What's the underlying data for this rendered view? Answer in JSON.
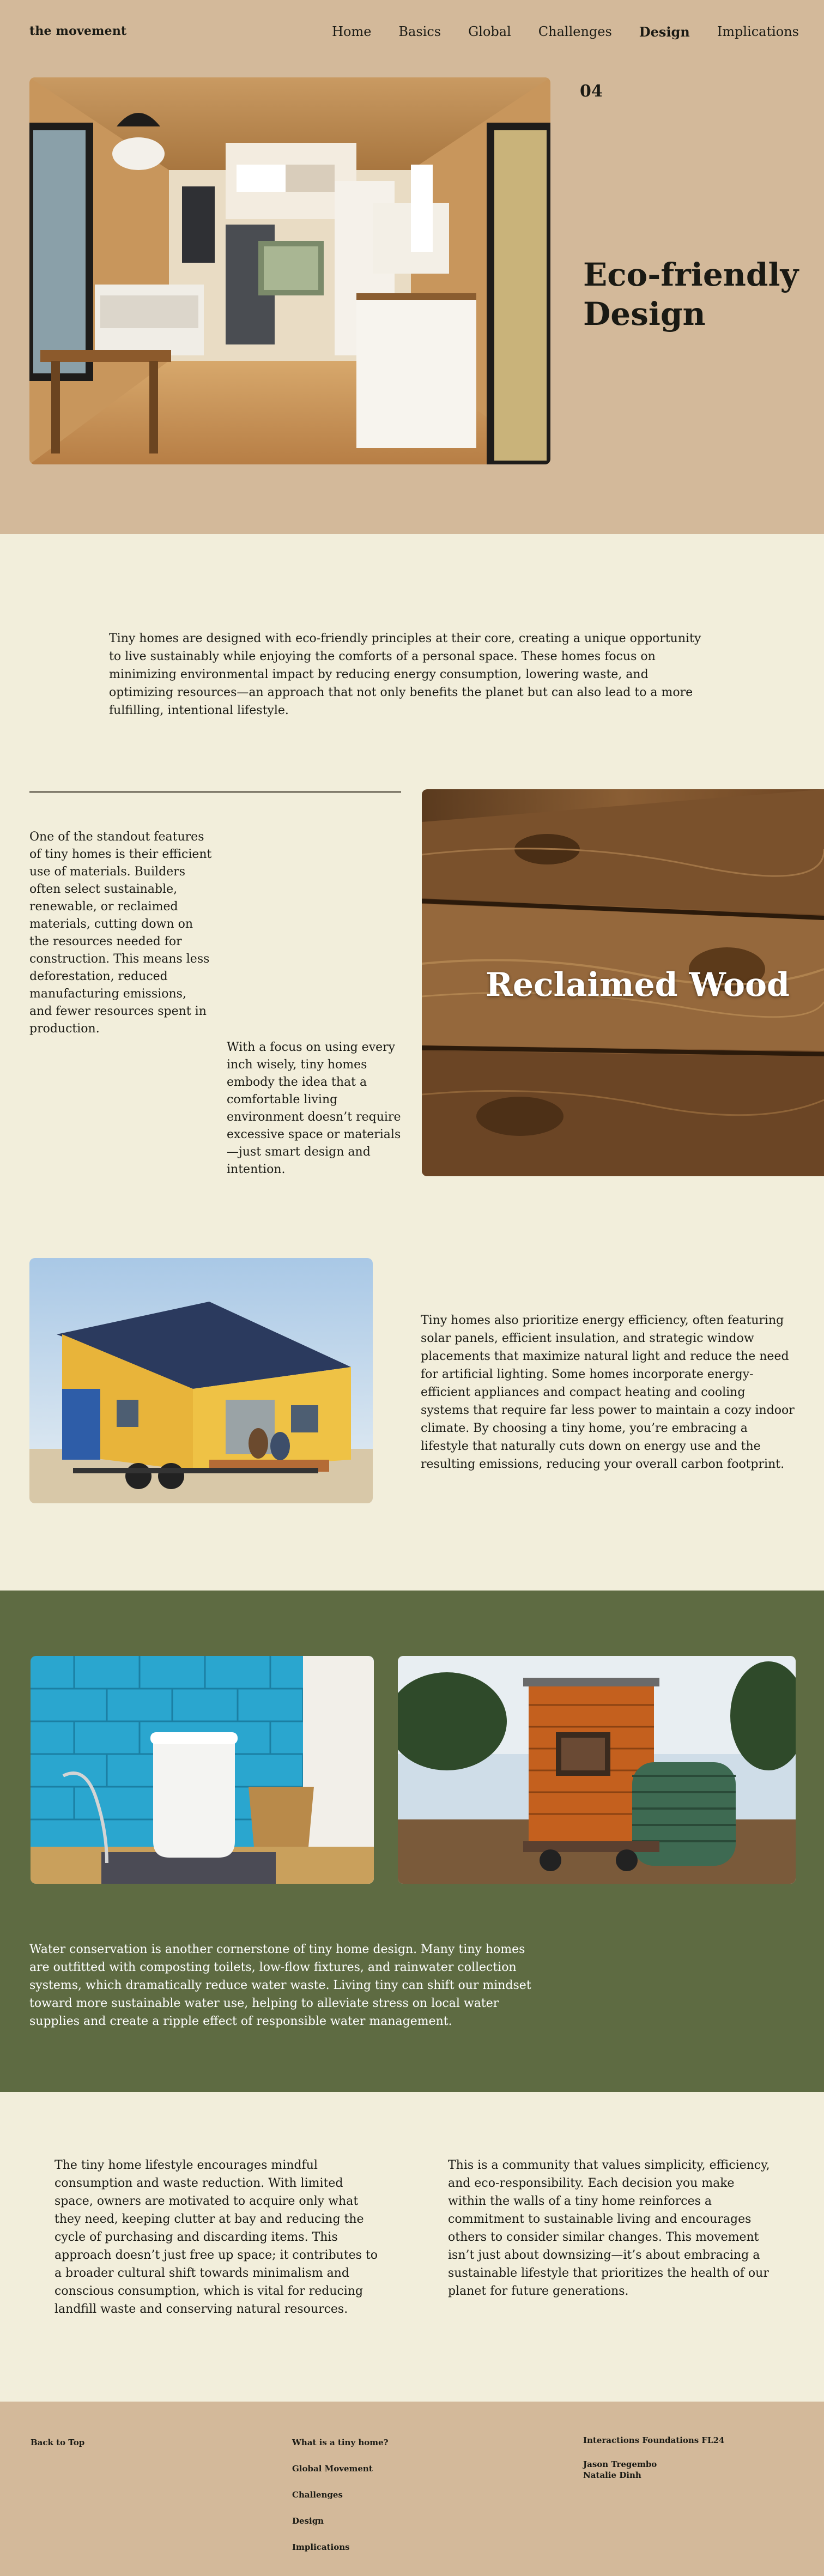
{
  "header": {
    "logo": "the movement",
    "nav": [
      "Home",
      "Basics",
      "Global",
      "Challenges",
      "Design",
      "Implications"
    ],
    "active": "Design"
  },
  "hero": {
    "number": "04",
    "title_line1": "Eco-friendly",
    "title_line2": "Design"
  },
  "intro": {
    "text": "Tiny homes are designed with eco-friendly principles at their core, creating a unique opportunity to live sustainably while enjoying the comforts of a personal space. These homes focus on minimizing environmental impact by reducing energy consumption, lowering waste, and optimizing resources—an approach that not only benefits the planet but can also lead to a more fulfilling, intentional lifestyle."
  },
  "wood": {
    "title": "Reclaimed Wood",
    "p1": "One of the standout features of tiny homes is their efficient use of materials. Builders often select sustainable, renewable, or reclaimed materials, cutting down on the resources needed for construction. This means less deforestation, reduced manufacturing emissions, and fewer resources spent in production.",
    "p2": "With a focus on using every inch wisely, tiny homes embody the idea that a comfortable living environment doesn’t require excessive space or materials—just smart design and intention."
  },
  "solar": {
    "text": "Tiny homes also prioritize energy efficiency, often featuring solar panels, efficient insulation, and strategic window placements that maximize natural light and reduce the need for artificial lighting. Some homes incorporate energy-efficient appliances and compact heating and cooling systems that require far less power to maintain a cozy indoor climate. By choosing a tiny home, you’re embracing a lifestyle that naturally cuts down on energy use and the resulting emissions, reducing your overall carbon footprint."
  },
  "water": {
    "text": "Water conservation is another cornerstone of tiny home design. Many tiny homes are outfitted with composting toilets, low-flow fixtures, and rainwater collection systems, which dramatically reduce water waste. Living tiny can shift our mindset toward more sustainable water use, helping to alleviate stress on local water supplies and create a ripple effect of responsible water management."
  },
  "community": {
    "left": "The tiny home lifestyle encourages mindful consumption and waste reduction. With limited space, owners are motivated to acquire only what they need, keeping clutter at bay and reducing the cycle of purchasing and discarding items. This approach doesn’t just free up space; it contributes to a broader cultural shift towards minimalism and conscious consumption, which is vital for reducing landfill waste and conserving natural resources.",
    "right": "This is a community that values simplicity, efficiency, and eco-responsibility. Each decision you make within the walls of a tiny home reinforces a commitment to sustainable living and encourages others to consider similar changes. This movement isn’t just about downsizing—it’s about embracing a sustainable lifestyle that prioritizes the health of our planet for future generations."
  },
  "footer": {
    "back_to_top": "Back to Top",
    "links": [
      "What is a tiny home?",
      "Global Movement",
      "Challenges",
      "Design",
      "Implications"
    ],
    "course": "Interactions Foundations FL24",
    "author1": "Jason Tregembo",
    "author2": "Natalie Dinh"
  }
}
